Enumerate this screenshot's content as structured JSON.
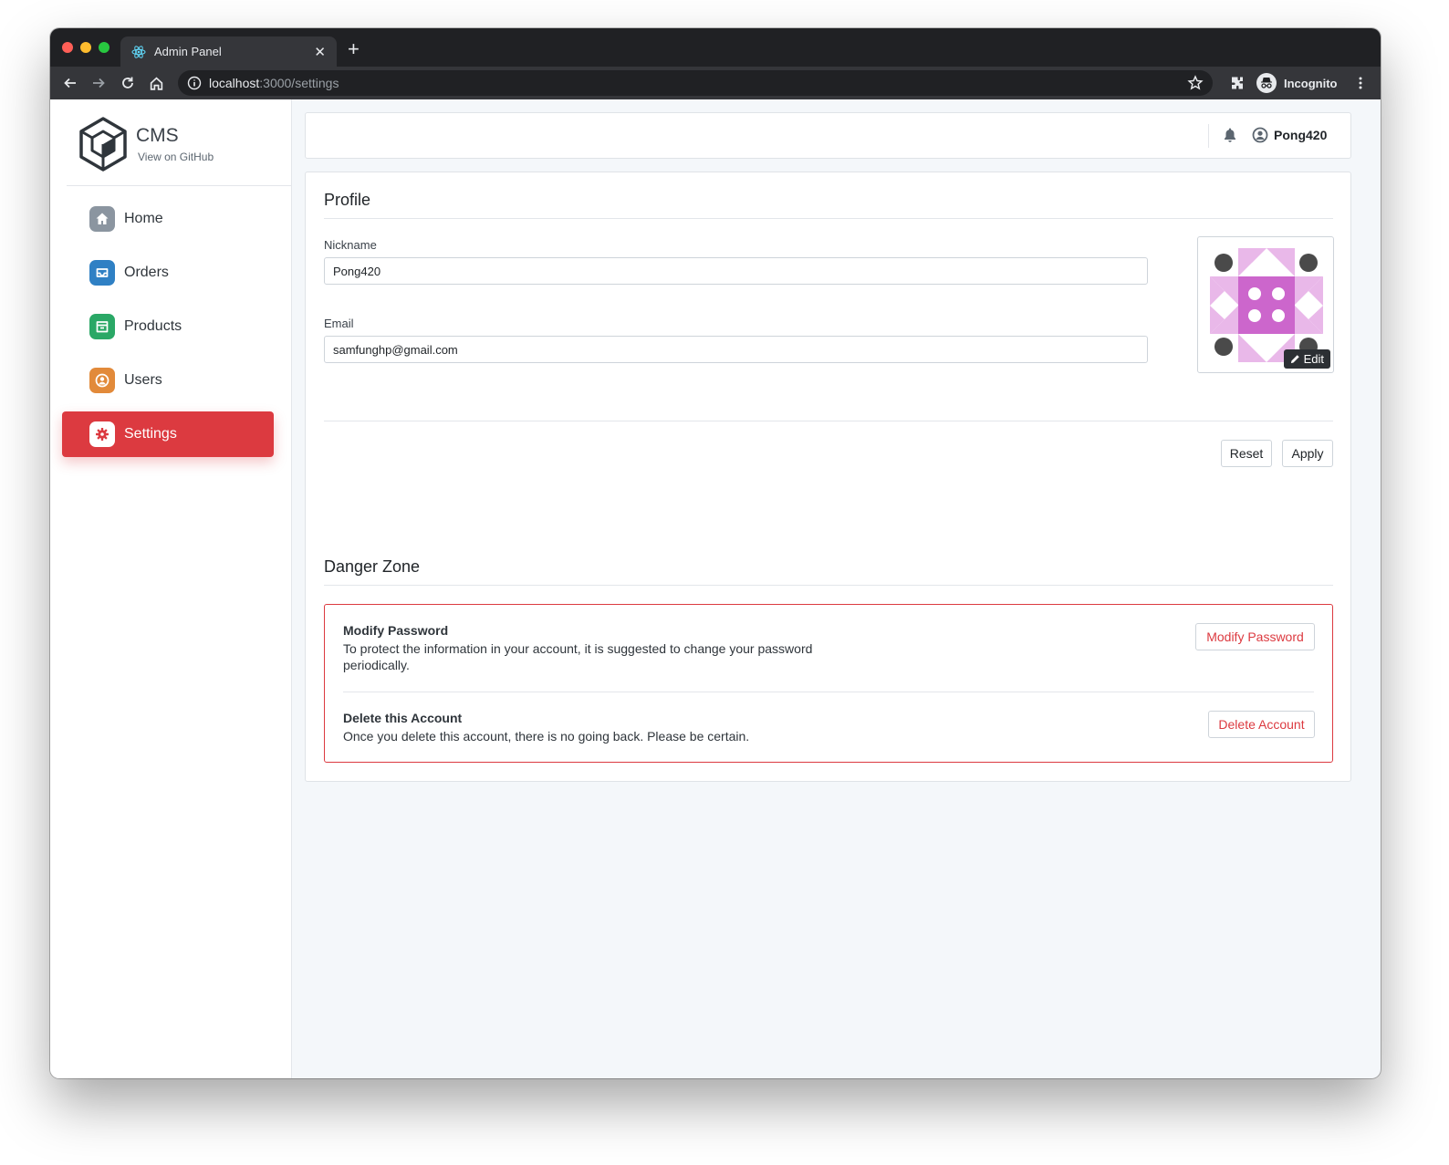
{
  "browser": {
    "tab_title": "Admin Panel",
    "url_host": "localhost",
    "url_path": ":3000/settings",
    "profile_label": "Incognito"
  },
  "sidebar": {
    "brand_name": "CMS",
    "brand_link": "View on GitHub",
    "items": [
      {
        "label": "Home",
        "icon": "home-icon",
        "color": "#8b95a0"
      },
      {
        "label": "Orders",
        "icon": "inbox-icon",
        "color": "#2f80c4"
      },
      {
        "label": "Products",
        "icon": "store-icon",
        "color": "#2aa866"
      },
      {
        "label": "Users",
        "icon": "user-icon",
        "color": "#e28a3a"
      },
      {
        "label": "Settings",
        "icon": "gear-icon",
        "color": "#dc3a40",
        "active": true
      }
    ]
  },
  "header": {
    "username": "Pong420"
  },
  "profile": {
    "title": "Profile",
    "nickname_label": "Nickname",
    "nickname_value": "Pong420",
    "email_label": "Email",
    "email_value": "samfunghp@gmail.com",
    "avatar_edit_label": "Edit",
    "reset_label": "Reset",
    "apply_label": "Apply"
  },
  "danger_zone": {
    "title": "Danger Zone",
    "modify_password": {
      "title": "Modify Password",
      "description": "To protect the information in your account, it is suggested to change your password periodically.",
      "button": "Modify Password"
    },
    "delete_account": {
      "title": "Delete this Account",
      "description": "Once you delete this account, there is no going back. Please be certain.",
      "button": "Delete Account"
    }
  },
  "colors": {
    "accent": "#dc3a40",
    "avatar_primary": "#cc66cc",
    "avatar_light": "#e9b8e9",
    "avatar_dot": "#4a4a4a"
  }
}
